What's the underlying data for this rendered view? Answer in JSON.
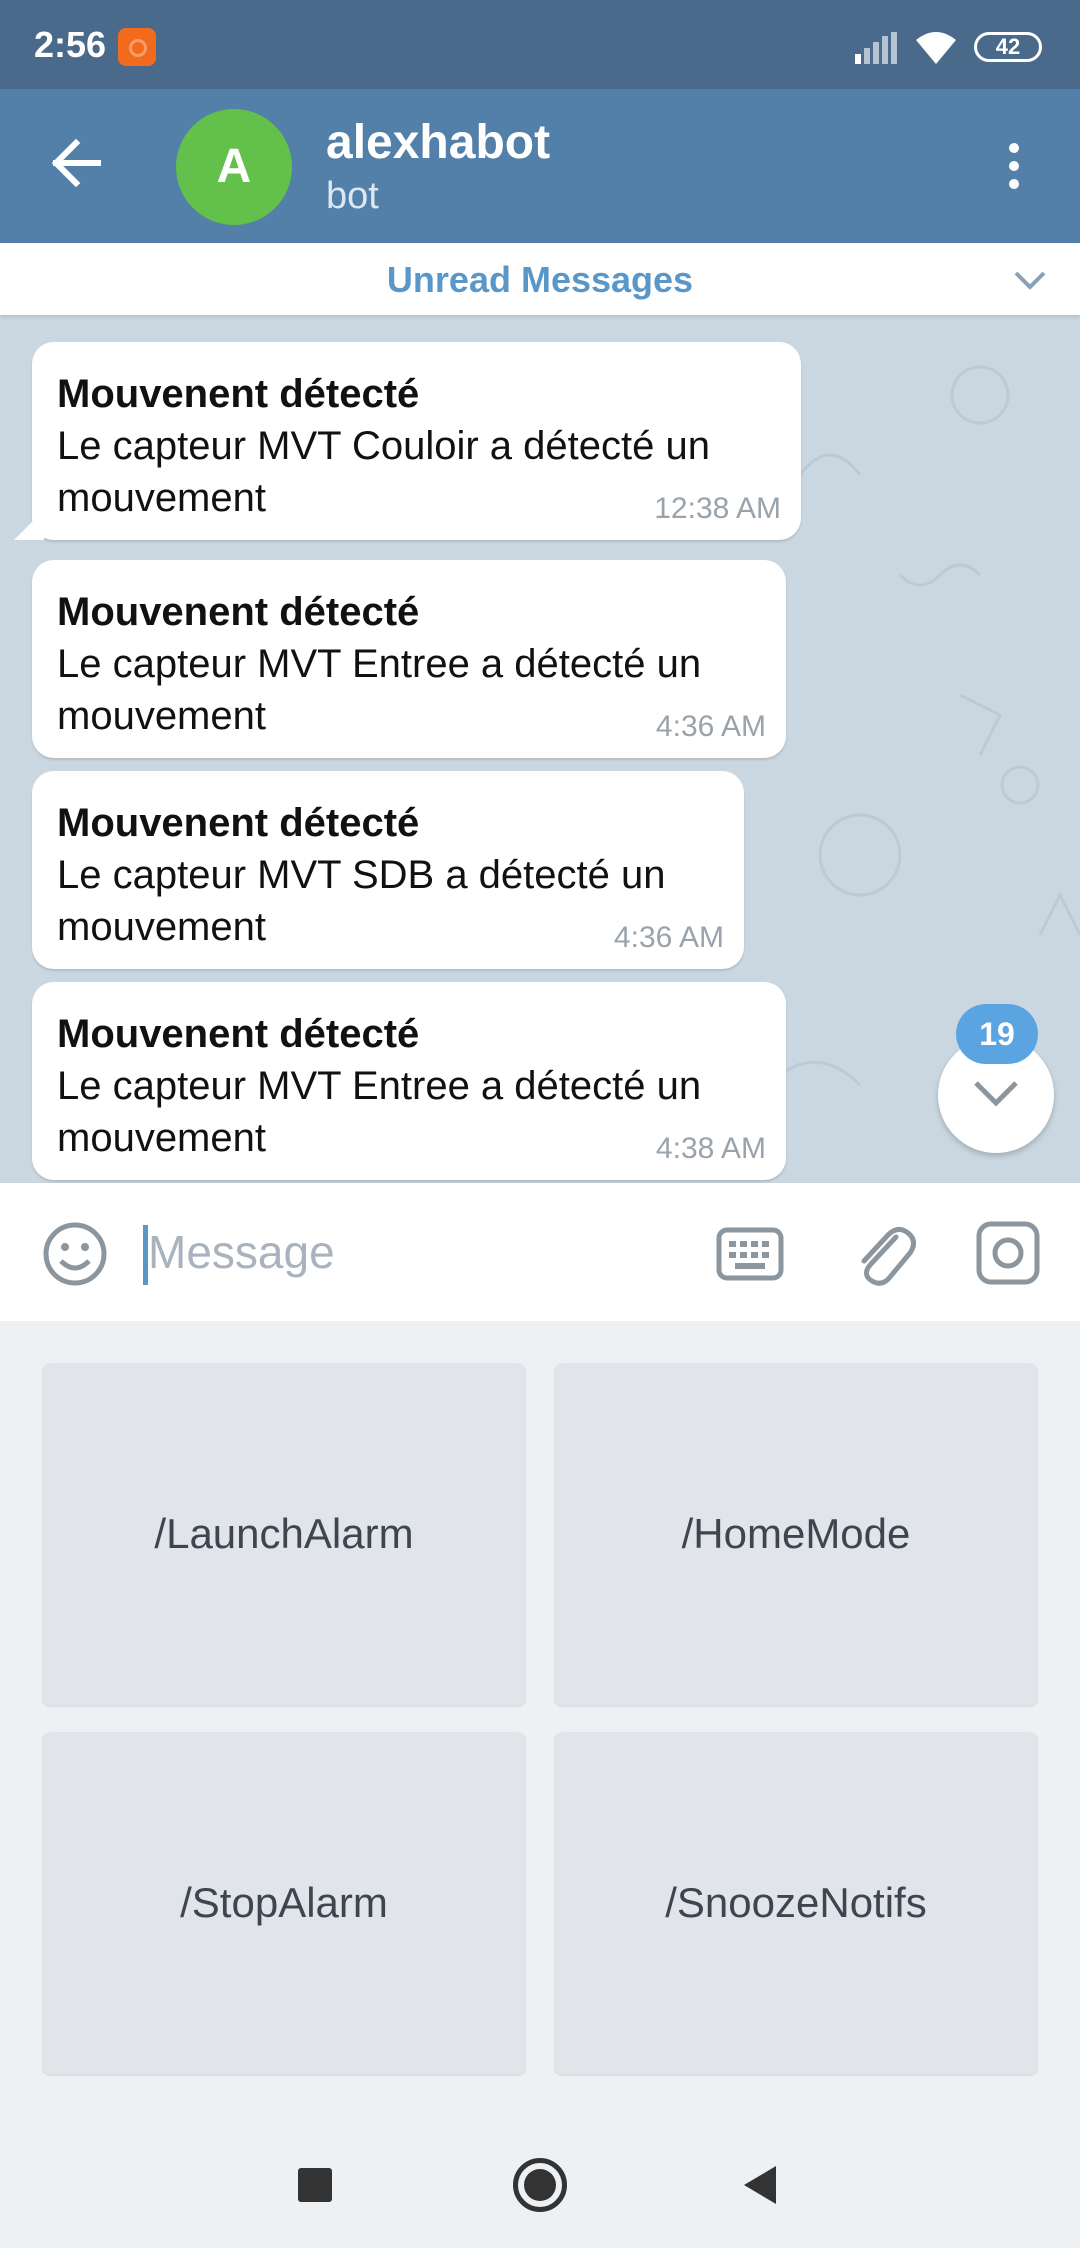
{
  "status_bar": {
    "time": "2:56",
    "battery": "42",
    "icons": [
      "app-notification-icon",
      "signal-icon",
      "wifi-icon",
      "battery-icon"
    ]
  },
  "header": {
    "avatar_letter": "A",
    "title": "alexhabot",
    "subtitle": "bot",
    "colors": {
      "bar": "#5380a8",
      "avatar": "#62c04b"
    }
  },
  "unread_banner": {
    "label": "Unread Messages"
  },
  "messages": [
    {
      "title": "Mouvenent détecté",
      "text": "Le capteur MVT Couloir a détecté un mouvement",
      "time": "12:38 AM"
    },
    {
      "title": "Mouvenent détecté",
      "text": "Le capteur MVT Entree a détecté un mouvement",
      "time": "4:36 AM"
    },
    {
      "title": "Mouvenent détecté",
      "text": "Le capteur MVT SDB a détecté un mouvement",
      "time": "4:36 AM"
    },
    {
      "title": "Mouvenent détecté",
      "text": "Le capteur MVT Entree a détecté un mouvement",
      "time": "4:38 AM"
    }
  ],
  "scroll_down": {
    "unread_count": "19"
  },
  "input": {
    "placeholder": "Message",
    "value": ""
  },
  "bot_keyboard": {
    "buttons": [
      "/LaunchAlarm",
      "/HomeMode",
      "/StopAlarm",
      "/SnoozeNotifs"
    ]
  }
}
